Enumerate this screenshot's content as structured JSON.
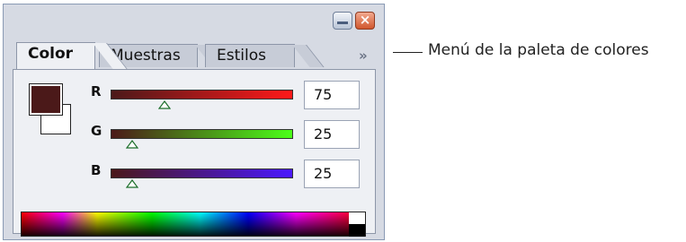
{
  "tabs": [
    {
      "label": "Color"
    },
    {
      "label": "Muestras"
    },
    {
      "label": "Estilos"
    }
  ],
  "menu_button": "»",
  "sliders": [
    {
      "label": "R",
      "value": "75"
    },
    {
      "label": "G",
      "value": "25"
    },
    {
      "label": "B",
      "value": "25"
    }
  ],
  "colors": {
    "foreground": "#4b1919",
    "background": "#ffffff"
  },
  "callout": {
    "text": "Menú de la paleta de colores"
  }
}
